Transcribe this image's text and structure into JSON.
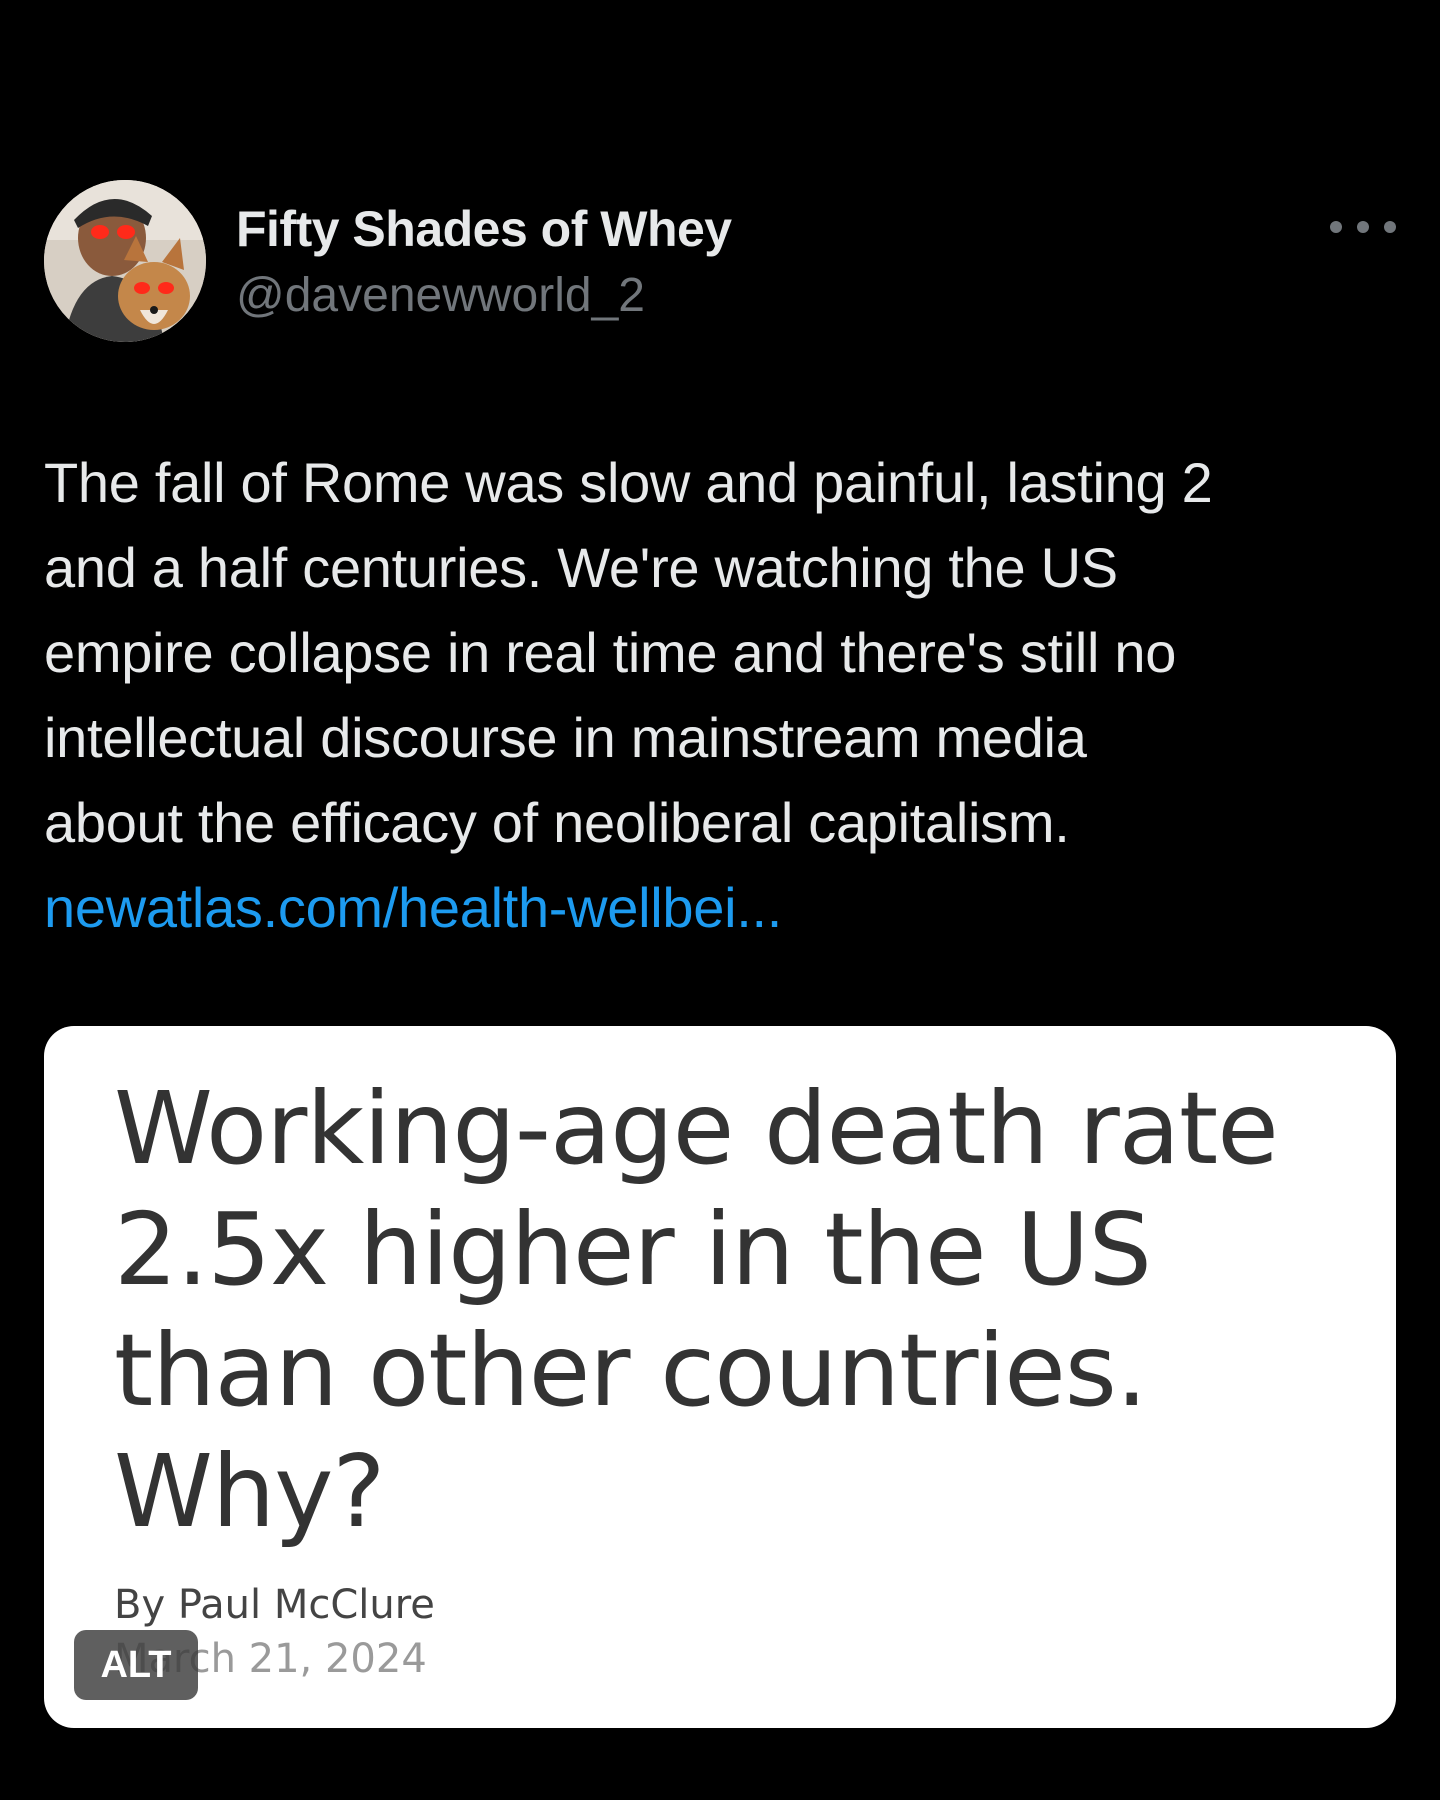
{
  "author": {
    "display_name": "Fifty Shades of Whey",
    "handle": "@davenewworld_2",
    "avatar_icon": "profile-avatar"
  },
  "more_icon": "more-horizontal-icon",
  "tweet": {
    "lines": [
      "The fall of Rome was slow and painful, lasting 2",
      "and a half centuries. We're watching the US",
      "empire collapse in real time and there's still no",
      "intellectual discourse in mainstream media",
      "about the efficacy of neoliberal capitalism."
    ],
    "link": "newatlas.com/health-wellbei..."
  },
  "media": {
    "headline_lines": [
      "Working-age death rate",
      "2.5x higher in the US",
      "than other countries.",
      "Why?"
    ],
    "byline": "By Paul McClure",
    "date": "March 21, 2024",
    "alt_label": "ALT"
  },
  "colors": {
    "background": "#000000",
    "primary_text": "#e7e9ea",
    "secondary_text": "#71767b",
    "link": "#1d9bf0",
    "card_background": "#ffffff",
    "headline_text": "#333333"
  }
}
